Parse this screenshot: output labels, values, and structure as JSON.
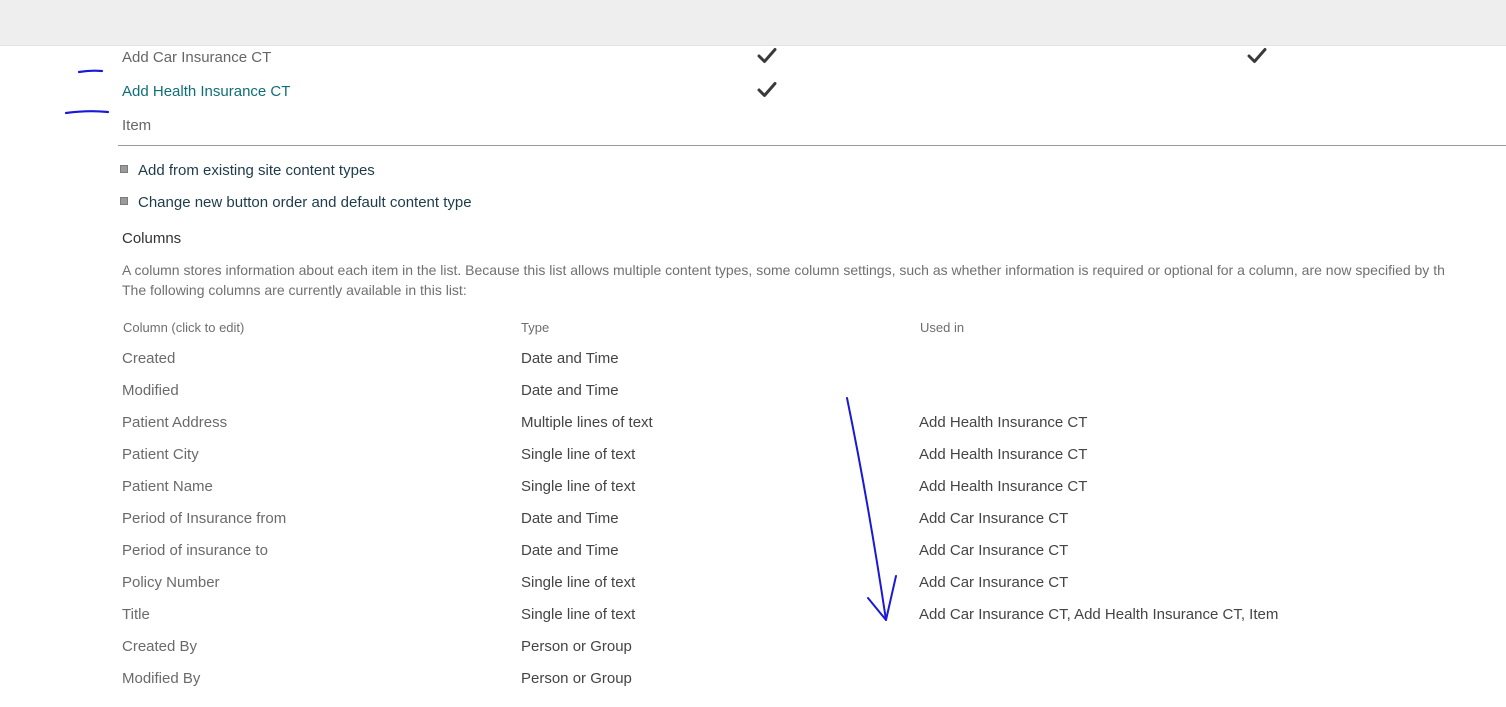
{
  "content_types": [
    {
      "name": "Add Car Insurance CT",
      "is_link": false,
      "visible_on_new": true,
      "default": true
    },
    {
      "name": "Add Health Insurance CT",
      "is_link": true,
      "visible_on_new": true,
      "default": false
    },
    {
      "name": "Item",
      "is_link": false,
      "visible_on_new": false,
      "default": false
    }
  ],
  "actions": [
    {
      "label": "Add from existing site content types"
    },
    {
      "label": "Change new button order and default content type"
    }
  ],
  "columns_section": {
    "title": "Columns",
    "description_line1": "A column stores information about each item in the list. Because this list allows multiple content types, some column settings, such as whether information is required or optional for a column, are now specified by th",
    "description_line2": "The following columns are currently available in this list:",
    "headers": {
      "column": "Column (click to edit)",
      "type": "Type",
      "used_in": "Used in"
    },
    "rows": [
      {
        "name": "Created",
        "type": "Date and Time",
        "used_in": ""
      },
      {
        "name": "Modified",
        "type": "Date and Time",
        "used_in": ""
      },
      {
        "name": "Patient Address",
        "type": "Multiple lines of text",
        "used_in": "Add Health Insurance CT"
      },
      {
        "name": "Patient City",
        "type": "Single line of text",
        "used_in": "Add Health Insurance CT"
      },
      {
        "name": "Patient Name",
        "type": "Single line of text",
        "used_in": "Add Health Insurance CT"
      },
      {
        "name": "Period of Insurance from",
        "type": "Date and Time",
        "used_in": "Add Car Insurance CT"
      },
      {
        "name": "Period of insurance to",
        "type": "Date and Time",
        "used_in": "Add Car Insurance CT"
      },
      {
        "name": "Policy Number",
        "type": "Single line of text",
        "used_in": "Add Car Insurance CT"
      },
      {
        "name": "Title",
        "type": "Single line of text",
        "used_in": "Add Car Insurance CT, Add Health Insurance CT, Item"
      },
      {
        "name": "Created By",
        "type": "Person or Group",
        "used_in": ""
      },
      {
        "name": "Modified By",
        "type": "Person or Group",
        "used_in": ""
      }
    ]
  },
  "colors": {
    "link": "#0f6f78",
    "annotation_ink": "#1a1ad6",
    "top_bar": "#eeeeee"
  },
  "icons": {
    "check": "check-icon"
  }
}
